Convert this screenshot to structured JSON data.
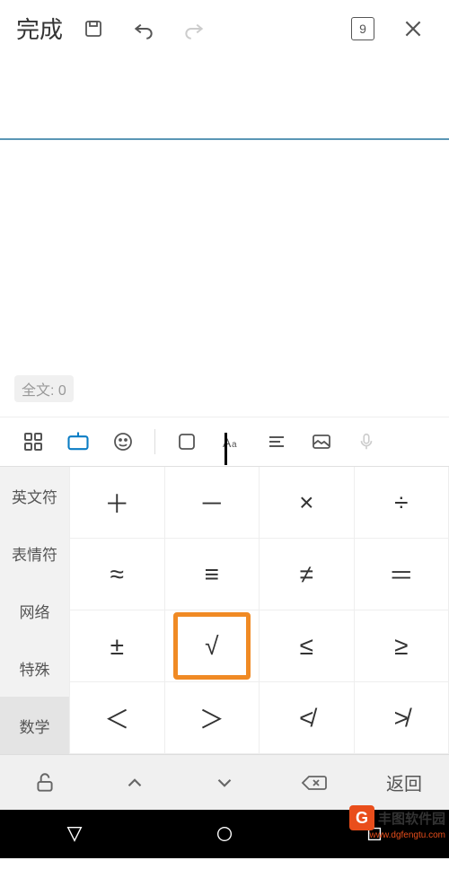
{
  "toolbar": {
    "done": "完成",
    "page_count": "9"
  },
  "content": {
    "word_count_label": "全文: 0"
  },
  "categories": [
    "英文符",
    "表情符",
    "网络",
    "特殊",
    "数学"
  ],
  "active_category_index": 4,
  "symbols": [
    [
      "＋",
      "－",
      "×",
      "÷"
    ],
    [
      "≈",
      "≡",
      "≠",
      "＝"
    ],
    [
      "±",
      "√",
      "≤",
      "≥"
    ],
    [
      "＜",
      "＞",
      "≮",
      "≯"
    ]
  ],
  "highlighted": {
    "row": 2,
    "col": 1
  },
  "bottom": {
    "return_label": "返回"
  },
  "watermark": {
    "logo_letter": "G",
    "text": "丰图软件园",
    "url": "www.dgfengtu.com"
  }
}
